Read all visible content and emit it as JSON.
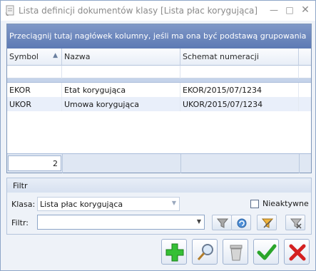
{
  "window": {
    "title": "Lista definicji dokumentów klasy [Lista płac korygująca]",
    "title_buttons": {
      "minimize": "—",
      "maximize": "□",
      "close": "✕"
    }
  },
  "grid": {
    "group_hint": "Przeciągnij tutaj nagłówek kolumny, jeśli ma ona być podstawą grupowania",
    "columns": [
      "Symbol",
      "Nazwa",
      "Schemat numeracji"
    ],
    "sort_indicator": "▲",
    "rows": [
      {
        "symbol": "EKOR",
        "nazwa": "Etat korygująca",
        "schemat": "EKOR/2015/07/1234"
      },
      {
        "symbol": "UKOR",
        "nazwa": "Umowa korygująca",
        "schemat": "UKOR/2015/07/1234"
      }
    ],
    "row_count": "2"
  },
  "filter_panel": {
    "title": "Filtr",
    "klasa_label": "Klasa:",
    "klasa_value": "Lista płac korygująca",
    "inactive_label": "Nieaktywne",
    "inactive_checked": false,
    "filter_label": "Filtr:",
    "filter_value": ""
  },
  "icons": {
    "app": "document-list-icon",
    "filter": "funnel-icon",
    "refresh": "refresh-icon",
    "construct_filter": "funnel-construct-icon",
    "clear_filter": "funnel-clear-icon",
    "add": "plus-icon",
    "preview": "magnifier-icon",
    "delete": "trash-icon",
    "confirm": "checkmark-icon",
    "cancel": "x-icon"
  },
  "colors": {
    "group_panel": "#6f88be",
    "selection_row": "#e9effa",
    "add": "#2fb52f",
    "confirm": "#2aa52a",
    "cancel": "#d42020"
  }
}
